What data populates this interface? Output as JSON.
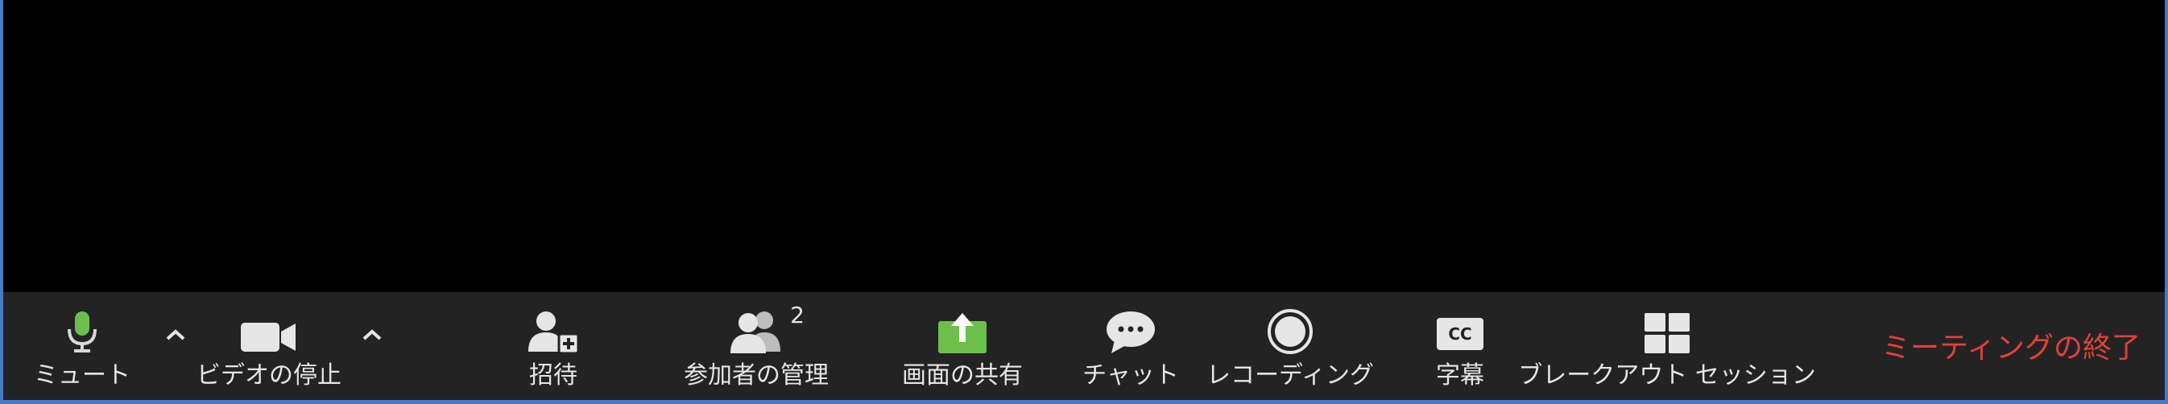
{
  "toolbar": {
    "mute": {
      "label": "ミュート",
      "icon": "microphone-icon"
    },
    "video": {
      "label": "ビデオの停止",
      "icon": "video-camera-icon"
    },
    "invite": {
      "label": "招待",
      "icon": "add-user-icon"
    },
    "participants": {
      "label": "参加者の管理",
      "count": "2",
      "icon": "participants-icon"
    },
    "share": {
      "label": "画面の共有",
      "icon": "share-screen-icon"
    },
    "chat": {
      "label": "チャット",
      "icon": "chat-bubble-icon"
    },
    "record": {
      "label": "レコーディング",
      "icon": "record-icon"
    },
    "captions": {
      "label": "字幕",
      "icon_text": "CC",
      "icon": "closed-caption-icon"
    },
    "breakout": {
      "label": "ブレークアウト セッション",
      "icon": "breakout-rooms-icon"
    },
    "end": {
      "label": "ミーティングの終了"
    }
  },
  "colors": {
    "frame": "#4a79c4",
    "toolbar_bg": "#232323",
    "mic_green": "#6cc04a",
    "share_green": "#6cc04a",
    "end_red": "#e0413b",
    "label": "#e6e6e6"
  }
}
